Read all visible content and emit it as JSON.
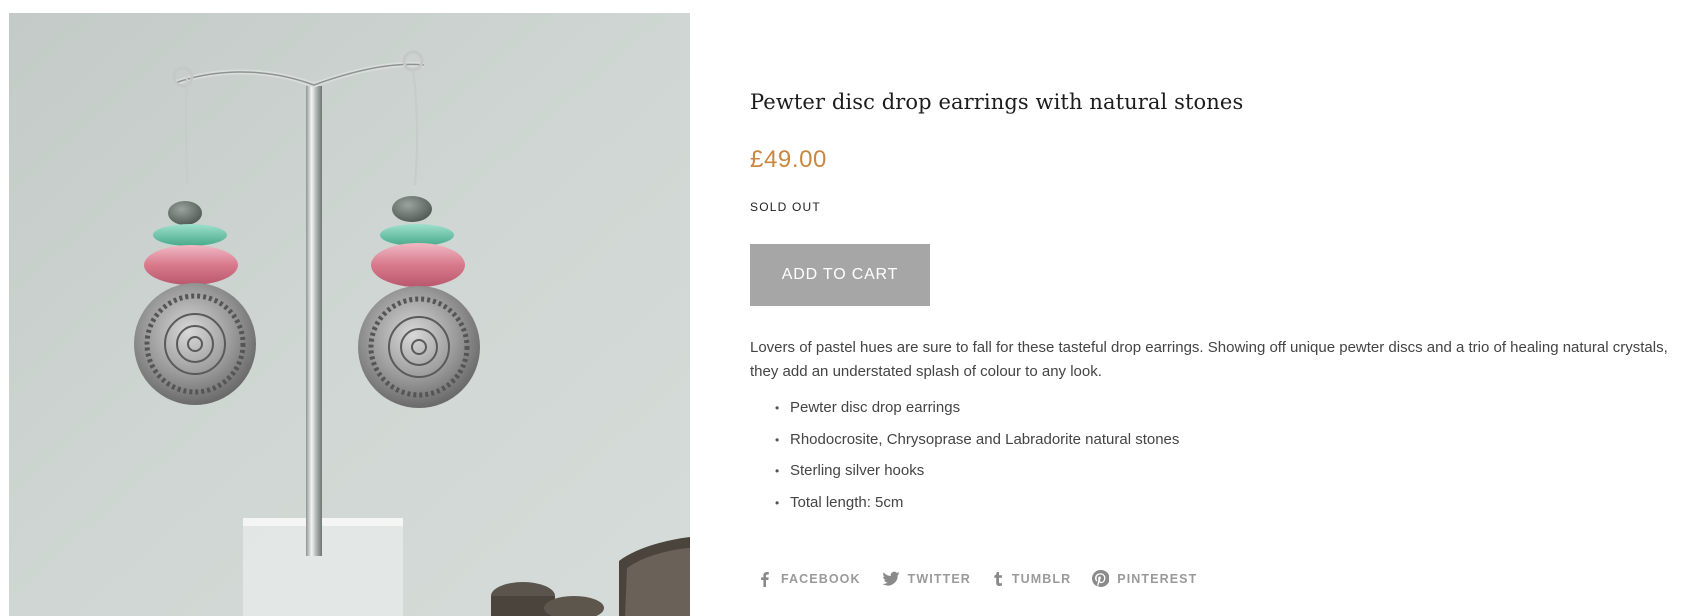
{
  "product": {
    "image_alt": "Pewter disc drop earrings with natural stones on a display stand",
    "title": "Pewter disc drop earrings with natural stones",
    "price": "£49.00",
    "stock_status": "SOLD OUT",
    "add_to_cart_label": "ADD TO CART",
    "description": "Lovers of pastel hues are sure to fall for these tasteful drop earrings. Showing off unique pewter discs and a trio of healing natural crystals, they add an understated splash of colour to any look.",
    "features": [
      "Pewter disc drop earrings",
      "Rhodocrosite, Chrysoprase and Labradorite natural stones",
      "Sterling silver hooks",
      "Total length: 5cm"
    ]
  },
  "share": [
    {
      "label": "FACEBOOK",
      "icon": "facebook-icon"
    },
    {
      "label": "TWITTER",
      "icon": "twitter-icon"
    },
    {
      "label": "TUMBLR",
      "icon": "tumblr-icon"
    },
    {
      "label": "PINTEREST",
      "icon": "pinterest-icon"
    }
  ],
  "colors": {
    "price": "#c9883f",
    "button_bg": "#a6a6a6",
    "button_text": "#ffffff",
    "share_text": "#9a9a9a"
  }
}
